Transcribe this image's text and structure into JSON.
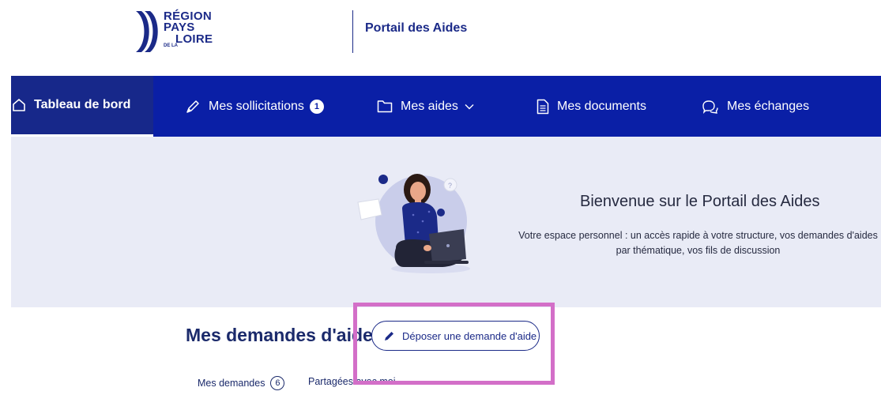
{
  "logo": {
    "line1": "RÉGION",
    "line2": "PAYS",
    "line3_small": "DE LA",
    "line3": "LOIRE"
  },
  "header": {
    "portal_title": "Portail des Aides"
  },
  "nav": {
    "items": [
      {
        "label": "Tableau de bord",
        "icon": "home-icon",
        "active": true
      },
      {
        "label": "Mes sollicitations",
        "icon": "pen-icon",
        "badge": "1"
      },
      {
        "label": "Mes aides",
        "icon": "folder-icon",
        "dropdown": true
      },
      {
        "label": "Mes documents",
        "icon": "document-icon"
      },
      {
        "label": "Mes échanges",
        "icon": "chat-icon"
      }
    ]
  },
  "banner": {
    "title": "Bienvenue sur le Portail des Aides",
    "text": "Votre espace personnel : un accès rapide à votre structure, vos demandes d'aides par thématique, vos fils de discussion"
  },
  "section": {
    "title": "Mes demandes d'aides",
    "deposit_button": "Déposer une demande d'aide",
    "tabs": [
      {
        "label": "Mes demandes",
        "count": "6"
      },
      {
        "label": "Partagées avec moi"
      }
    ]
  },
  "colors": {
    "nav_bg": "#0a1fa6",
    "nav_active_bg": "#17288a",
    "banner_bg": "#e9ebf6",
    "highlight": "#d36fc8",
    "brand": "#1b2a88"
  }
}
